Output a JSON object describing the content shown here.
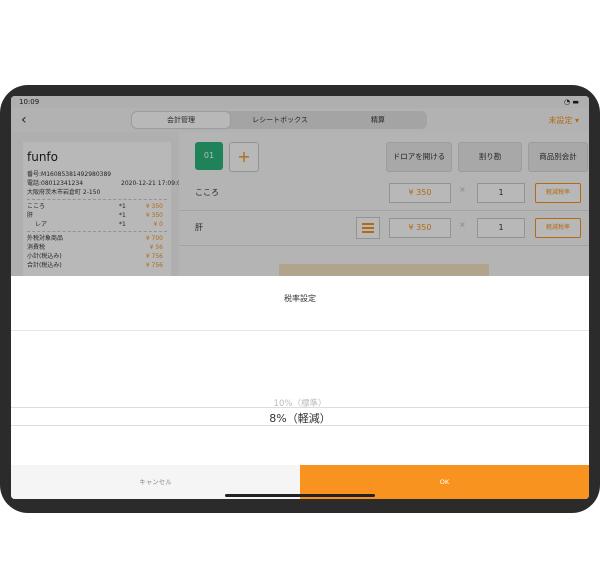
{
  "status": {
    "time": "10:09",
    "system": "􀙇 ▮"
  },
  "nav": {
    "tabs": [
      "会計管理",
      "レシートボックス",
      "精算"
    ],
    "tax_setting": "未設定 ▾"
  },
  "receipt": {
    "shop": "funfo",
    "number": "番号:M16085381492980389",
    "phone": "電話:08012341234",
    "datetime": "2020-12-21 17:09:09",
    "address": "大阪府茨木市岩倉町 2-150",
    "items": [
      {
        "name": "こころ",
        "qty": "*1",
        "price": "¥ 350"
      },
      {
        "name": "肝",
        "qty": "*1",
        "price": "¥ 350"
      },
      {
        "name": "レア",
        "qty": "*1",
        "price": "¥ 0"
      }
    ],
    "totals": [
      {
        "name": "外税対象商品",
        "price": "¥ 700"
      },
      {
        "name": "消費税",
        "price": "¥ 56"
      },
      {
        "name": "小計(税込み)",
        "price": "¥ 756"
      },
      {
        "name": "合計(税込み)",
        "price": "¥ 756"
      }
    ]
  },
  "main": {
    "ticket_label": "01",
    "add_label": "+",
    "open_drawer": "ドロアを開ける",
    "discount": "割り勘",
    "per_item": "商品別会計",
    "items": [
      {
        "name": "こころ",
        "price": "¥ 350",
        "qty": "1",
        "rate": "軽減税率"
      },
      {
        "name": "肝",
        "price": "¥ 350",
        "qty": "1",
        "rate": "軽減税率"
      }
    ],
    "times": "×"
  },
  "sheet": {
    "title": "税率設定",
    "options": [
      "10%（標準）",
      "8%（軽減）"
    ],
    "cancel": "キャンセル",
    "ok": "OK"
  },
  "colors": {
    "accent": "#f7931e",
    "green": "#2cb67d"
  }
}
